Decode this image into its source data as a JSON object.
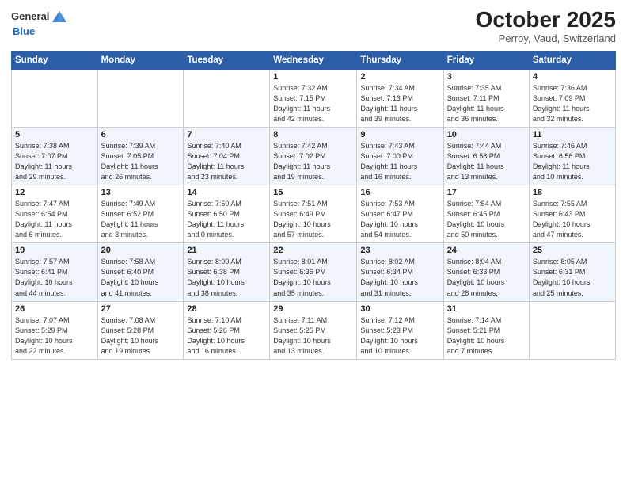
{
  "header": {
    "logo_general": "General",
    "logo_blue": "Blue",
    "month_title": "October 2025",
    "location": "Perroy, Vaud, Switzerland"
  },
  "days_of_week": [
    "Sunday",
    "Monday",
    "Tuesday",
    "Wednesday",
    "Thursday",
    "Friday",
    "Saturday"
  ],
  "weeks": [
    [
      {
        "day": "",
        "info": ""
      },
      {
        "day": "",
        "info": ""
      },
      {
        "day": "",
        "info": ""
      },
      {
        "day": "1",
        "info": "Sunrise: 7:32 AM\nSunset: 7:15 PM\nDaylight: 11 hours\nand 42 minutes."
      },
      {
        "day": "2",
        "info": "Sunrise: 7:34 AM\nSunset: 7:13 PM\nDaylight: 11 hours\nand 39 minutes."
      },
      {
        "day": "3",
        "info": "Sunrise: 7:35 AM\nSunset: 7:11 PM\nDaylight: 11 hours\nand 36 minutes."
      },
      {
        "day": "4",
        "info": "Sunrise: 7:36 AM\nSunset: 7:09 PM\nDaylight: 11 hours\nand 32 minutes."
      }
    ],
    [
      {
        "day": "5",
        "info": "Sunrise: 7:38 AM\nSunset: 7:07 PM\nDaylight: 11 hours\nand 29 minutes."
      },
      {
        "day": "6",
        "info": "Sunrise: 7:39 AM\nSunset: 7:05 PM\nDaylight: 11 hours\nand 26 minutes."
      },
      {
        "day": "7",
        "info": "Sunrise: 7:40 AM\nSunset: 7:04 PM\nDaylight: 11 hours\nand 23 minutes."
      },
      {
        "day": "8",
        "info": "Sunrise: 7:42 AM\nSunset: 7:02 PM\nDaylight: 11 hours\nand 19 minutes."
      },
      {
        "day": "9",
        "info": "Sunrise: 7:43 AM\nSunset: 7:00 PM\nDaylight: 11 hours\nand 16 minutes."
      },
      {
        "day": "10",
        "info": "Sunrise: 7:44 AM\nSunset: 6:58 PM\nDaylight: 11 hours\nand 13 minutes."
      },
      {
        "day": "11",
        "info": "Sunrise: 7:46 AM\nSunset: 6:56 PM\nDaylight: 11 hours\nand 10 minutes."
      }
    ],
    [
      {
        "day": "12",
        "info": "Sunrise: 7:47 AM\nSunset: 6:54 PM\nDaylight: 11 hours\nand 6 minutes."
      },
      {
        "day": "13",
        "info": "Sunrise: 7:49 AM\nSunset: 6:52 PM\nDaylight: 11 hours\nand 3 minutes."
      },
      {
        "day": "14",
        "info": "Sunrise: 7:50 AM\nSunset: 6:50 PM\nDaylight: 11 hours\nand 0 minutes."
      },
      {
        "day": "15",
        "info": "Sunrise: 7:51 AM\nSunset: 6:49 PM\nDaylight: 10 hours\nand 57 minutes."
      },
      {
        "day": "16",
        "info": "Sunrise: 7:53 AM\nSunset: 6:47 PM\nDaylight: 10 hours\nand 54 minutes."
      },
      {
        "day": "17",
        "info": "Sunrise: 7:54 AM\nSunset: 6:45 PM\nDaylight: 10 hours\nand 50 minutes."
      },
      {
        "day": "18",
        "info": "Sunrise: 7:55 AM\nSunset: 6:43 PM\nDaylight: 10 hours\nand 47 minutes."
      }
    ],
    [
      {
        "day": "19",
        "info": "Sunrise: 7:57 AM\nSunset: 6:41 PM\nDaylight: 10 hours\nand 44 minutes."
      },
      {
        "day": "20",
        "info": "Sunrise: 7:58 AM\nSunset: 6:40 PM\nDaylight: 10 hours\nand 41 minutes."
      },
      {
        "day": "21",
        "info": "Sunrise: 8:00 AM\nSunset: 6:38 PM\nDaylight: 10 hours\nand 38 minutes."
      },
      {
        "day": "22",
        "info": "Sunrise: 8:01 AM\nSunset: 6:36 PM\nDaylight: 10 hours\nand 35 minutes."
      },
      {
        "day": "23",
        "info": "Sunrise: 8:02 AM\nSunset: 6:34 PM\nDaylight: 10 hours\nand 31 minutes."
      },
      {
        "day": "24",
        "info": "Sunrise: 8:04 AM\nSunset: 6:33 PM\nDaylight: 10 hours\nand 28 minutes."
      },
      {
        "day": "25",
        "info": "Sunrise: 8:05 AM\nSunset: 6:31 PM\nDaylight: 10 hours\nand 25 minutes."
      }
    ],
    [
      {
        "day": "26",
        "info": "Sunrise: 7:07 AM\nSunset: 5:29 PM\nDaylight: 10 hours\nand 22 minutes."
      },
      {
        "day": "27",
        "info": "Sunrise: 7:08 AM\nSunset: 5:28 PM\nDaylight: 10 hours\nand 19 minutes."
      },
      {
        "day": "28",
        "info": "Sunrise: 7:10 AM\nSunset: 5:26 PM\nDaylight: 10 hours\nand 16 minutes."
      },
      {
        "day": "29",
        "info": "Sunrise: 7:11 AM\nSunset: 5:25 PM\nDaylight: 10 hours\nand 13 minutes."
      },
      {
        "day": "30",
        "info": "Sunrise: 7:12 AM\nSunset: 5:23 PM\nDaylight: 10 hours\nand 10 minutes."
      },
      {
        "day": "31",
        "info": "Sunrise: 7:14 AM\nSunset: 5:21 PM\nDaylight: 10 hours\nand 7 minutes."
      },
      {
        "day": "",
        "info": ""
      }
    ]
  ]
}
